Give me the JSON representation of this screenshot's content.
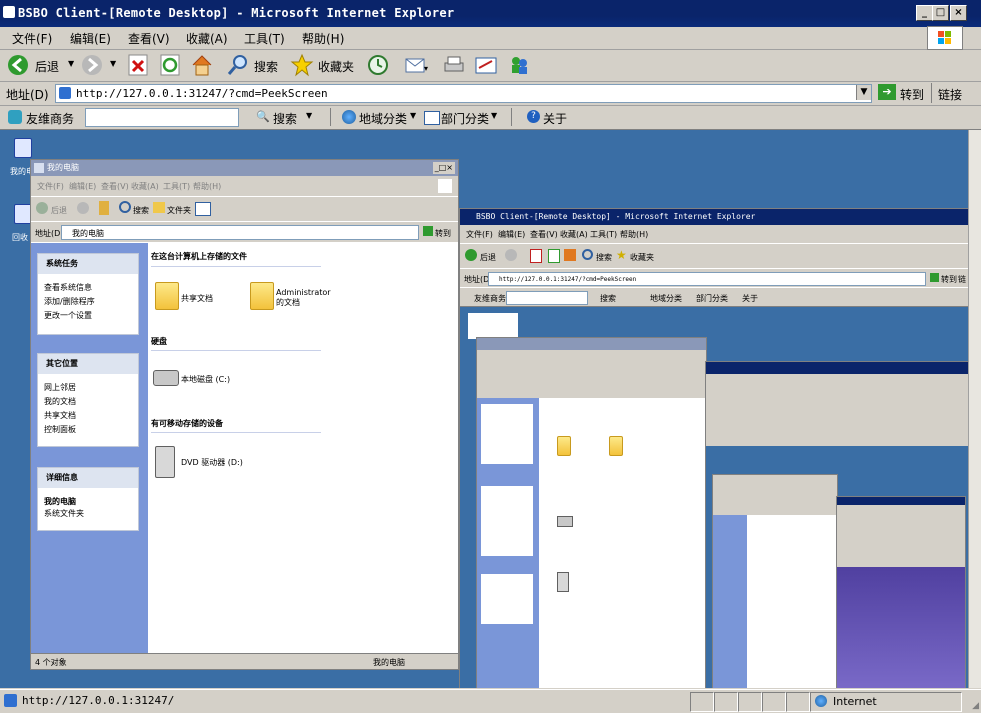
{
  "window": {
    "title": "BSBO Client-[Remote Desktop] - Microsoft Internet Explorer",
    "buttons": {
      "minimize": "_",
      "maximize": "□",
      "close": "×"
    }
  },
  "menu": {
    "items": [
      "文件(F)",
      "编辑(E)",
      "查看(V)",
      "收藏(A)",
      "工具(T)",
      "帮助(H)"
    ]
  },
  "toolbar": {
    "back": "后退",
    "search": "搜索",
    "favorites": "收藏夹"
  },
  "address": {
    "label": "地址(D)",
    "url": "http://127.0.0.1:31247/?cmd=PeekScreen",
    "go": "转到",
    "links": "链接"
  },
  "linksbar": {
    "brand": "友维商务",
    "search": "搜索",
    "region": "地域分类",
    "dept": "部门分类",
    "about": "关于"
  },
  "remote": {
    "desktop_icons": [
      "我的电",
      "回收"
    ],
    "explorer": {
      "title": "我的电脑",
      "menu": [
        "文件(F)",
        "编辑(E)",
        "查看(V)",
        "收藏(A)",
        "工具(T)",
        "帮助(H)"
      ],
      "toolbar": {
        "back": "后退",
        "search": "搜索",
        "folders": "文件夹"
      },
      "address_label": "地址(D)",
      "address": "我的电脑",
      "go": "转到",
      "tasks": {
        "system_title": "系统任务",
        "system_items": [
          "查看系统信息",
          "添加/删除程序",
          "更改一个设置"
        ],
        "other_title": "其它位置",
        "other_items": [
          "网上邻居",
          "我的文档",
          "共享文档",
          "控制面板"
        ],
        "details_title": "详细信息",
        "details_text": [
          "我的电脑",
          "系统文件夹"
        ]
      },
      "section_files": "在这台计算机上存储的文件",
      "shared_docs": "共享文档",
      "admin_docs": "Administrator 的文档",
      "section_disks": "硬盘",
      "local_disk": "本地磁盘 (C:)",
      "section_removable": "有可移动存储的设备",
      "dvd": "DVD 驱动器 (D:)",
      "status_left": "4 个对象",
      "status_right": "我的电脑"
    },
    "nested_ie": {
      "title": "BSBO Client-[Remote Desktop] - Microsoft Internet Explorer",
      "menu": [
        "文件(F)",
        "编辑(E)",
        "查看(V)",
        "收藏(A)",
        "工具(T)",
        "帮助(H)"
      ],
      "back": "后退",
      "search": "搜索",
      "favorites": "收藏夹",
      "address_label": "地址(D)",
      "url": "http://127.0.0.1:31247/?cmd=PeekScreen",
      "go": "转到",
      "links": "链",
      "brand": "友维商务",
      "linksbar_search": "搜索",
      "region": "地域分类",
      "dept": "部门分类",
      "about": "关于"
    }
  },
  "status": {
    "url": "http://127.0.0.1:31247/",
    "zone": "Internet"
  },
  "colors": {
    "titlebar": "#0a246a",
    "desktop": "#3a6ea5",
    "chrome": "#d4d0c8"
  }
}
